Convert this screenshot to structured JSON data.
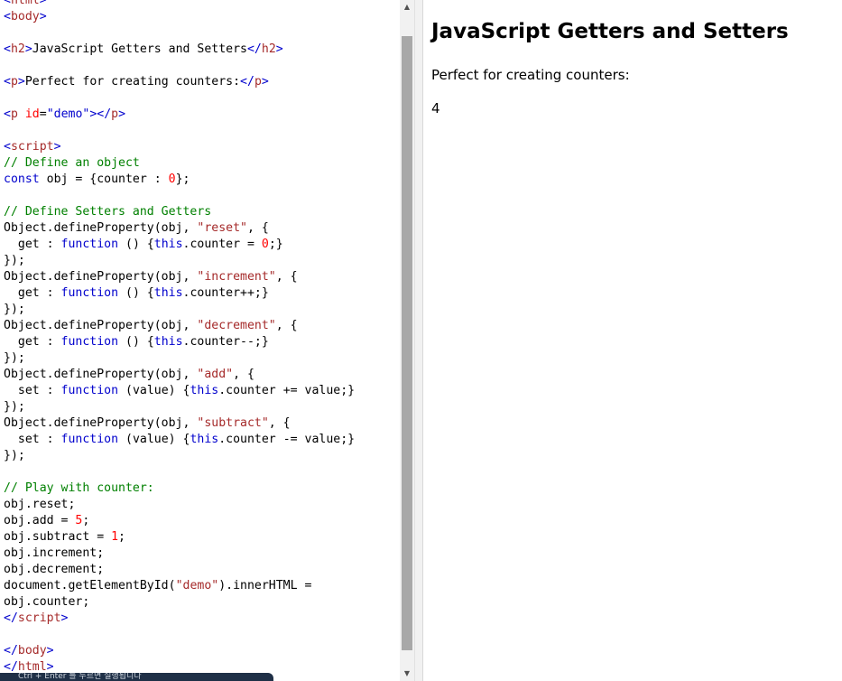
{
  "code_lines": [
    [
      {
        "c": "t-br",
        "t": "<"
      },
      {
        "c": "t-tag",
        "t": "html"
      },
      {
        "c": "t-br",
        "t": ">"
      }
    ],
    [
      {
        "c": "t-br",
        "t": "<"
      },
      {
        "c": "t-tag",
        "t": "body"
      },
      {
        "c": "t-br",
        "t": ">"
      }
    ],
    [],
    [
      {
        "c": "t-br",
        "t": "<"
      },
      {
        "c": "t-tag",
        "t": "h2"
      },
      {
        "c": "t-br",
        "t": ">"
      },
      {
        "c": "t-pl",
        "t": "JavaScript Getters and Setters"
      },
      {
        "c": "t-br",
        "t": "</"
      },
      {
        "c": "t-tag",
        "t": "h2"
      },
      {
        "c": "t-br",
        "t": ">"
      }
    ],
    [],
    [
      {
        "c": "t-br",
        "t": "<"
      },
      {
        "c": "t-tag",
        "t": "p"
      },
      {
        "c": "t-br",
        "t": ">"
      },
      {
        "c": "t-pl",
        "t": "Perfect for creating counters:"
      },
      {
        "c": "t-br",
        "t": "</"
      },
      {
        "c": "t-tag",
        "t": "p"
      },
      {
        "c": "t-br",
        "t": ">"
      }
    ],
    [],
    [
      {
        "c": "t-br",
        "t": "<"
      },
      {
        "c": "t-tag",
        "t": "p "
      },
      {
        "c": "t-attr",
        "t": "id"
      },
      {
        "c": "t-pl",
        "t": "="
      },
      {
        "c": "t-kw",
        "t": "\"demo\""
      },
      {
        "c": "t-br",
        "t": "></"
      },
      {
        "c": "t-tag",
        "t": "p"
      },
      {
        "c": "t-br",
        "t": ">"
      }
    ],
    [],
    [
      {
        "c": "t-br",
        "t": "<"
      },
      {
        "c": "t-tag",
        "t": "script"
      },
      {
        "c": "t-br",
        "t": ">"
      }
    ],
    [
      {
        "c": "t-cm",
        "t": "// Define an object"
      }
    ],
    [
      {
        "c": "t-kw",
        "t": "const"
      },
      {
        "c": "t-pl",
        "t": " obj = {counter : "
      },
      {
        "c": "t-num",
        "t": "0"
      },
      {
        "c": "t-pl",
        "t": "};"
      }
    ],
    [],
    [
      {
        "c": "t-cm",
        "t": "// Define Setters and Getters"
      }
    ],
    [
      {
        "c": "t-pl",
        "t": "Object.defineProperty(obj, "
      },
      {
        "c": "t-str",
        "t": "\"reset\""
      },
      {
        "c": "t-pl",
        "t": ", {"
      }
    ],
    [
      {
        "c": "t-pl",
        "t": "  get : "
      },
      {
        "c": "t-kw",
        "t": "function"
      },
      {
        "c": "t-pl",
        "t": " () {"
      },
      {
        "c": "t-kw",
        "t": "this"
      },
      {
        "c": "t-pl",
        "t": ".counter = "
      },
      {
        "c": "t-num",
        "t": "0"
      },
      {
        "c": "t-pl",
        "t": ";}"
      }
    ],
    [
      {
        "c": "t-pl",
        "t": "});"
      }
    ],
    [
      {
        "c": "t-pl",
        "t": "Object.defineProperty(obj, "
      },
      {
        "c": "t-str",
        "t": "\"increment\""
      },
      {
        "c": "t-pl",
        "t": ", {"
      }
    ],
    [
      {
        "c": "t-pl",
        "t": "  get : "
      },
      {
        "c": "t-kw",
        "t": "function"
      },
      {
        "c": "t-pl",
        "t": " () {"
      },
      {
        "c": "t-kw",
        "t": "this"
      },
      {
        "c": "t-pl",
        "t": ".counter++;}"
      }
    ],
    [
      {
        "c": "t-pl",
        "t": "});"
      }
    ],
    [
      {
        "c": "t-pl",
        "t": "Object.defineProperty(obj, "
      },
      {
        "c": "t-str",
        "t": "\"decrement\""
      },
      {
        "c": "t-pl",
        "t": ", {"
      }
    ],
    [
      {
        "c": "t-pl",
        "t": "  get : "
      },
      {
        "c": "t-kw",
        "t": "function"
      },
      {
        "c": "t-pl",
        "t": " () {"
      },
      {
        "c": "t-kw",
        "t": "this"
      },
      {
        "c": "t-pl",
        "t": ".counter--;}"
      }
    ],
    [
      {
        "c": "t-pl",
        "t": "});"
      }
    ],
    [
      {
        "c": "t-pl",
        "t": "Object.defineProperty(obj, "
      },
      {
        "c": "t-str",
        "t": "\"add\""
      },
      {
        "c": "t-pl",
        "t": ", {"
      }
    ],
    [
      {
        "c": "t-pl",
        "t": "  set : "
      },
      {
        "c": "t-kw",
        "t": "function"
      },
      {
        "c": "t-pl",
        "t": " (value) {"
      },
      {
        "c": "t-kw",
        "t": "this"
      },
      {
        "c": "t-pl",
        "t": ".counter += value;}"
      }
    ],
    [
      {
        "c": "t-pl",
        "t": "});"
      }
    ],
    [
      {
        "c": "t-pl",
        "t": "Object.defineProperty(obj, "
      },
      {
        "c": "t-str",
        "t": "\"subtract\""
      },
      {
        "c": "t-pl",
        "t": ", {"
      }
    ],
    [
      {
        "c": "t-pl",
        "t": "  set : "
      },
      {
        "c": "t-kw",
        "t": "function"
      },
      {
        "c": "t-pl",
        "t": " (value) {"
      },
      {
        "c": "t-kw",
        "t": "this"
      },
      {
        "c": "t-pl",
        "t": ".counter -= value;}"
      }
    ],
    [
      {
        "c": "t-pl",
        "t": "});"
      }
    ],
    [],
    [
      {
        "c": "t-cm",
        "t": "// Play with counter:"
      }
    ],
    [
      {
        "c": "t-pl",
        "t": "obj.reset;"
      }
    ],
    [
      {
        "c": "t-pl",
        "t": "obj.add = "
      },
      {
        "c": "t-num",
        "t": "5"
      },
      {
        "c": "t-pl",
        "t": ";"
      }
    ],
    [
      {
        "c": "t-pl",
        "t": "obj.subtract = "
      },
      {
        "c": "t-num",
        "t": "1"
      },
      {
        "c": "t-pl",
        "t": ";"
      }
    ],
    [
      {
        "c": "t-pl",
        "t": "obj.increment;"
      }
    ],
    [
      {
        "c": "t-pl",
        "t": "obj.decrement;"
      }
    ],
    [
      {
        "c": "t-pl",
        "t": "document.getElementById("
      },
      {
        "c": "t-str",
        "t": "\"demo\""
      },
      {
        "c": "t-pl",
        "t": ").innerHTML ="
      }
    ],
    [
      {
        "c": "t-pl",
        "t": "obj.counter;"
      }
    ],
    [
      {
        "c": "t-br",
        "t": "</"
      },
      {
        "c": "t-tag",
        "t": "script"
      },
      {
        "c": "t-br",
        "t": ">"
      }
    ],
    [],
    [
      {
        "c": "t-br",
        "t": "</"
      },
      {
        "c": "t-tag",
        "t": "body"
      },
      {
        "c": "t-br",
        "t": ">"
      }
    ],
    [
      {
        "c": "t-br",
        "t": "</"
      },
      {
        "c": "t-tag",
        "t": "html"
      },
      {
        "c": "t-br",
        "t": ">"
      }
    ]
  ],
  "scrollbar": {
    "up_icon": "▲",
    "down_icon": "▼"
  },
  "result": {
    "heading": "JavaScript Getters and Setters",
    "text": "Perfect for creating counters:",
    "demo": "4"
  },
  "toast": {
    "text": "Ctrl + Enter 를 누르면 실행됩니다"
  },
  "colors": {
    "tag": "#a52a2a",
    "bracket": "#0000cd",
    "keyword": "#0000cd",
    "comment": "#008000",
    "number": "#ff0000",
    "toast_bg": "#1f3047"
  }
}
